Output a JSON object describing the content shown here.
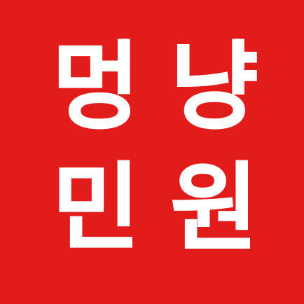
{
  "colors": {
    "background": "#e21b1b",
    "text": "#ffffff"
  },
  "logo": {
    "row1": {
      "left": "멍",
      "right": "냥"
    },
    "row2": {
      "left": "민",
      "right": "원"
    }
  }
}
